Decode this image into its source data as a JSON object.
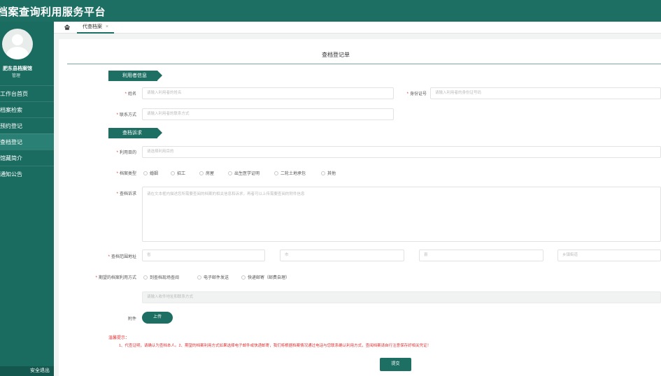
{
  "app": {
    "title": "档案查询利用服务平台"
  },
  "sidebar": {
    "user": {
      "name": "肥东县档案馆",
      "role": "管理"
    },
    "items": [
      {
        "label": "工作台首页"
      },
      {
        "label": "档案检索"
      },
      {
        "label": "预约登记"
      },
      {
        "label": "查档登记"
      },
      {
        "label": "馆藏简介"
      },
      {
        "label": "通知公告"
      }
    ],
    "active_index": 3,
    "footer": "安全退出"
  },
  "tabs": [
    {
      "label": "代查档案",
      "close": "×"
    }
  ],
  "form": {
    "title": "查档登记单",
    "sections": {
      "user_info": "利用者信息",
      "request": "查档诉求"
    },
    "fields": {
      "name": {
        "label": "姓名",
        "placeholder": "请输入利用者的姓名"
      },
      "id_number": {
        "label": "身份证号",
        "placeholder": "请输入利用者的身份证号码"
      },
      "contact": {
        "label": "联系方式",
        "placeholder": "请输入利用者的联系方式"
      },
      "purpose": {
        "label": "利用目的",
        "placeholder": "请选择利用目的"
      },
      "archive_type": {
        "label": "档案类型",
        "options": [
          "婚姻",
          "招工",
          "房屋",
          "出生医学证明",
          "二轮土地承包",
          "其他"
        ]
      },
      "description": {
        "label": "查档诉求",
        "placeholder": "请在文本框内描述您所需要查阅的档案的相关信息和诉求，再者可以上传需要查阅的附件信息"
      },
      "region": {
        "label": "查档范围地址",
        "selects": [
          "省",
          "市",
          "县",
          "乡镇街道"
        ]
      },
      "delivery": {
        "label": "期望的档案利用方式",
        "options": [
          "到查档现场查阅",
          "电子邮件发送",
          "快递邮寄（邮费自理）"
        ],
        "detail_placeholder": "请输入收件地址和联系方式"
      },
      "attachment": {
        "label": "附件",
        "button": "上传"
      }
    },
    "tips": {
      "title": "温馨提示：",
      "text": "1、代查证明，请确认为查档本人。2、期望的档案利用方式如果选择电子邮件或快递邮寄，我们将根据档案情况通过电话与您联系确认利用方式，查阅档案请自行注意保存好相关凭证！"
    },
    "submit": "提交"
  },
  "colors": {
    "brand": "#1d6e63",
    "sidebar": "#1a6b60",
    "warning": "#d33333"
  }
}
